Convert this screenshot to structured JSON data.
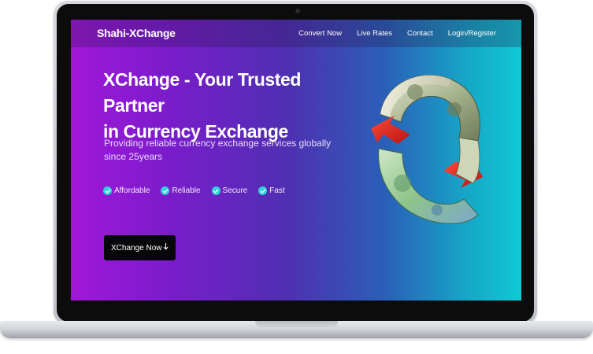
{
  "header": {
    "brand": "Shahi-XChange",
    "nav": [
      "Convert Now",
      "Live Rates",
      "Contact",
      "Login/Register"
    ]
  },
  "hero": {
    "title_line1": "XChange - Your Trusted Partner",
    "title_line2": "in Currency Exchange",
    "subtitle": "Providing reliable currency exchange services globally since 25years",
    "features": [
      "Affordable",
      "Reliable",
      "Secure",
      "Fast"
    ],
    "cta_label": "XChange Now",
    "cta_icon": "arrow-down-icon"
  },
  "theme": {
    "gradient_start": "#a117d9",
    "gradient_end": "#10c9d4",
    "check_color": "#2fd3d8",
    "cta_bg": "#07070a"
  },
  "icons": {
    "feature_check": "check-circle-icon",
    "hero_image": "currency-exchange-illustration"
  }
}
